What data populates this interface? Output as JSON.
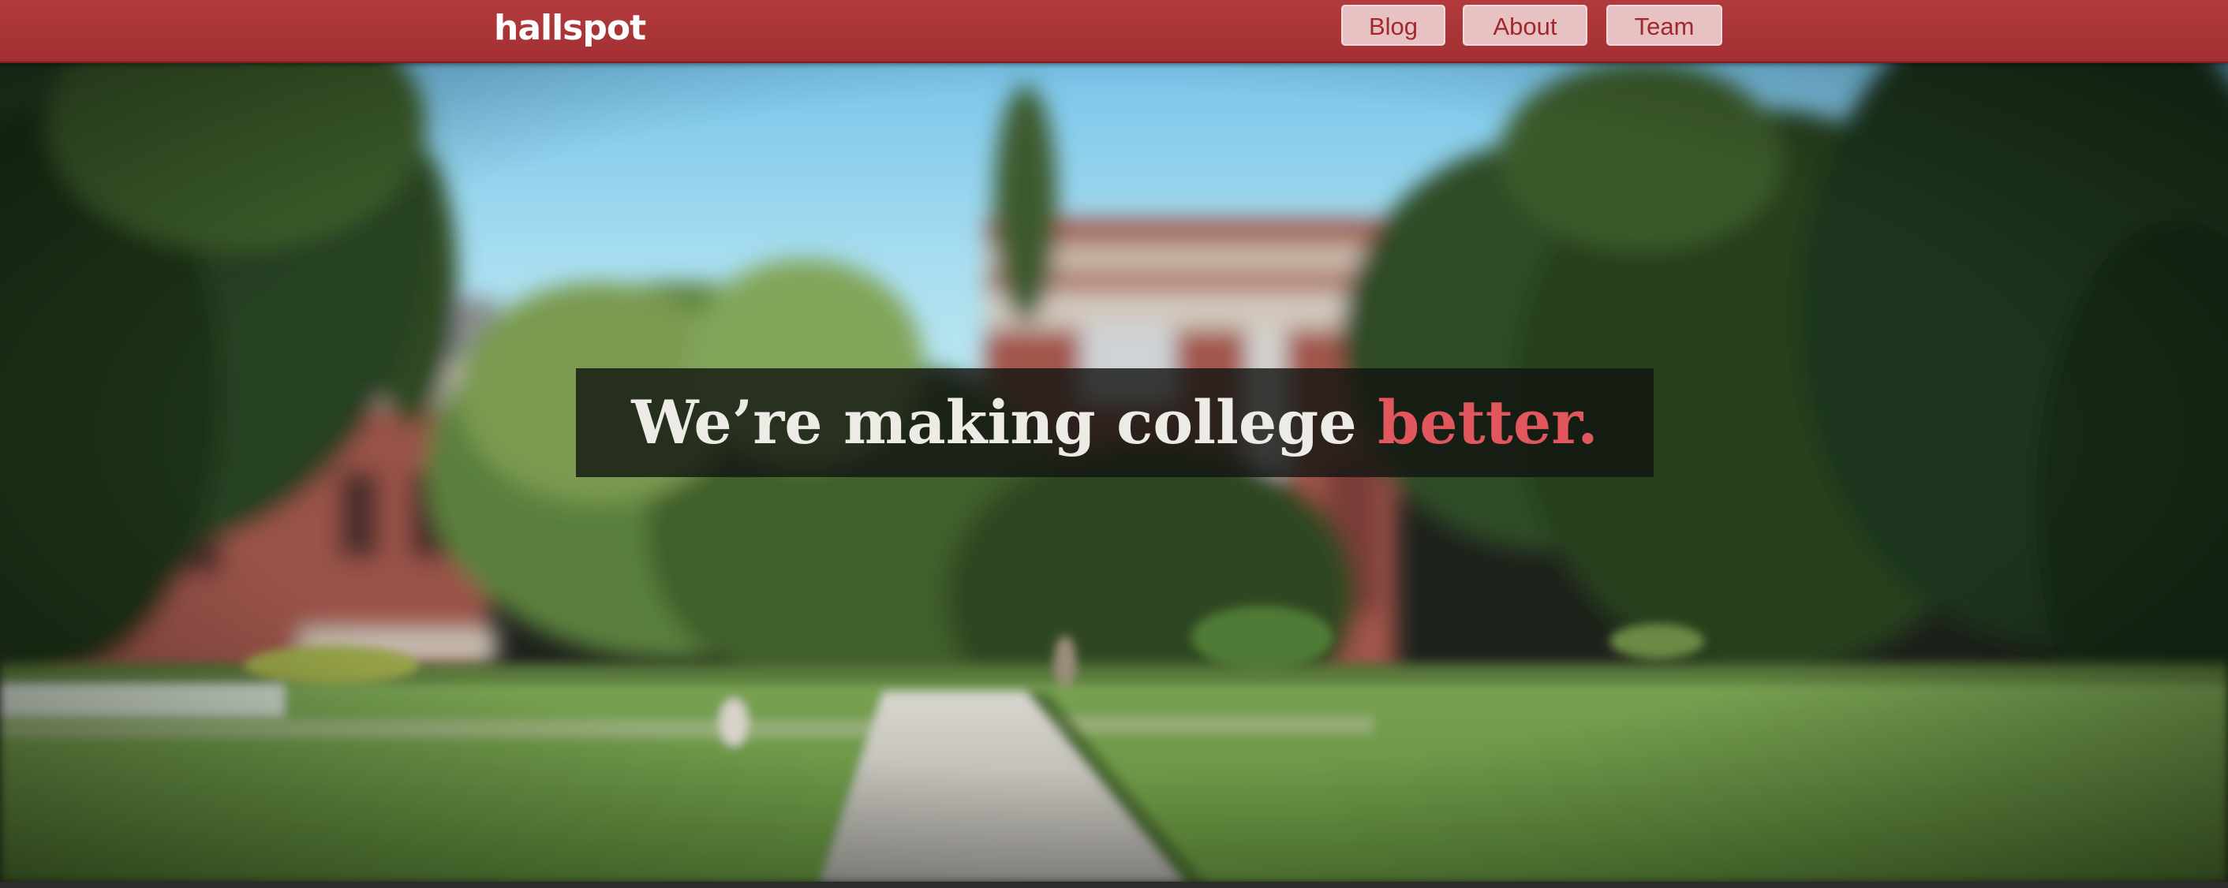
{
  "brand": {
    "logo_text": "hallspot"
  },
  "nav": {
    "items": [
      {
        "label": "Blog"
      },
      {
        "label": "About"
      },
      {
        "label": "Team"
      }
    ]
  },
  "hero": {
    "headline_main": "We’re making college ",
    "headline_accent": "better."
  },
  "colors": {
    "nav_background": "#a83436",
    "nav_button_background": "#e8c2c3",
    "nav_button_text": "#a3282c",
    "headline_text": "#ecebe6",
    "headline_accent": "#e2575d"
  }
}
